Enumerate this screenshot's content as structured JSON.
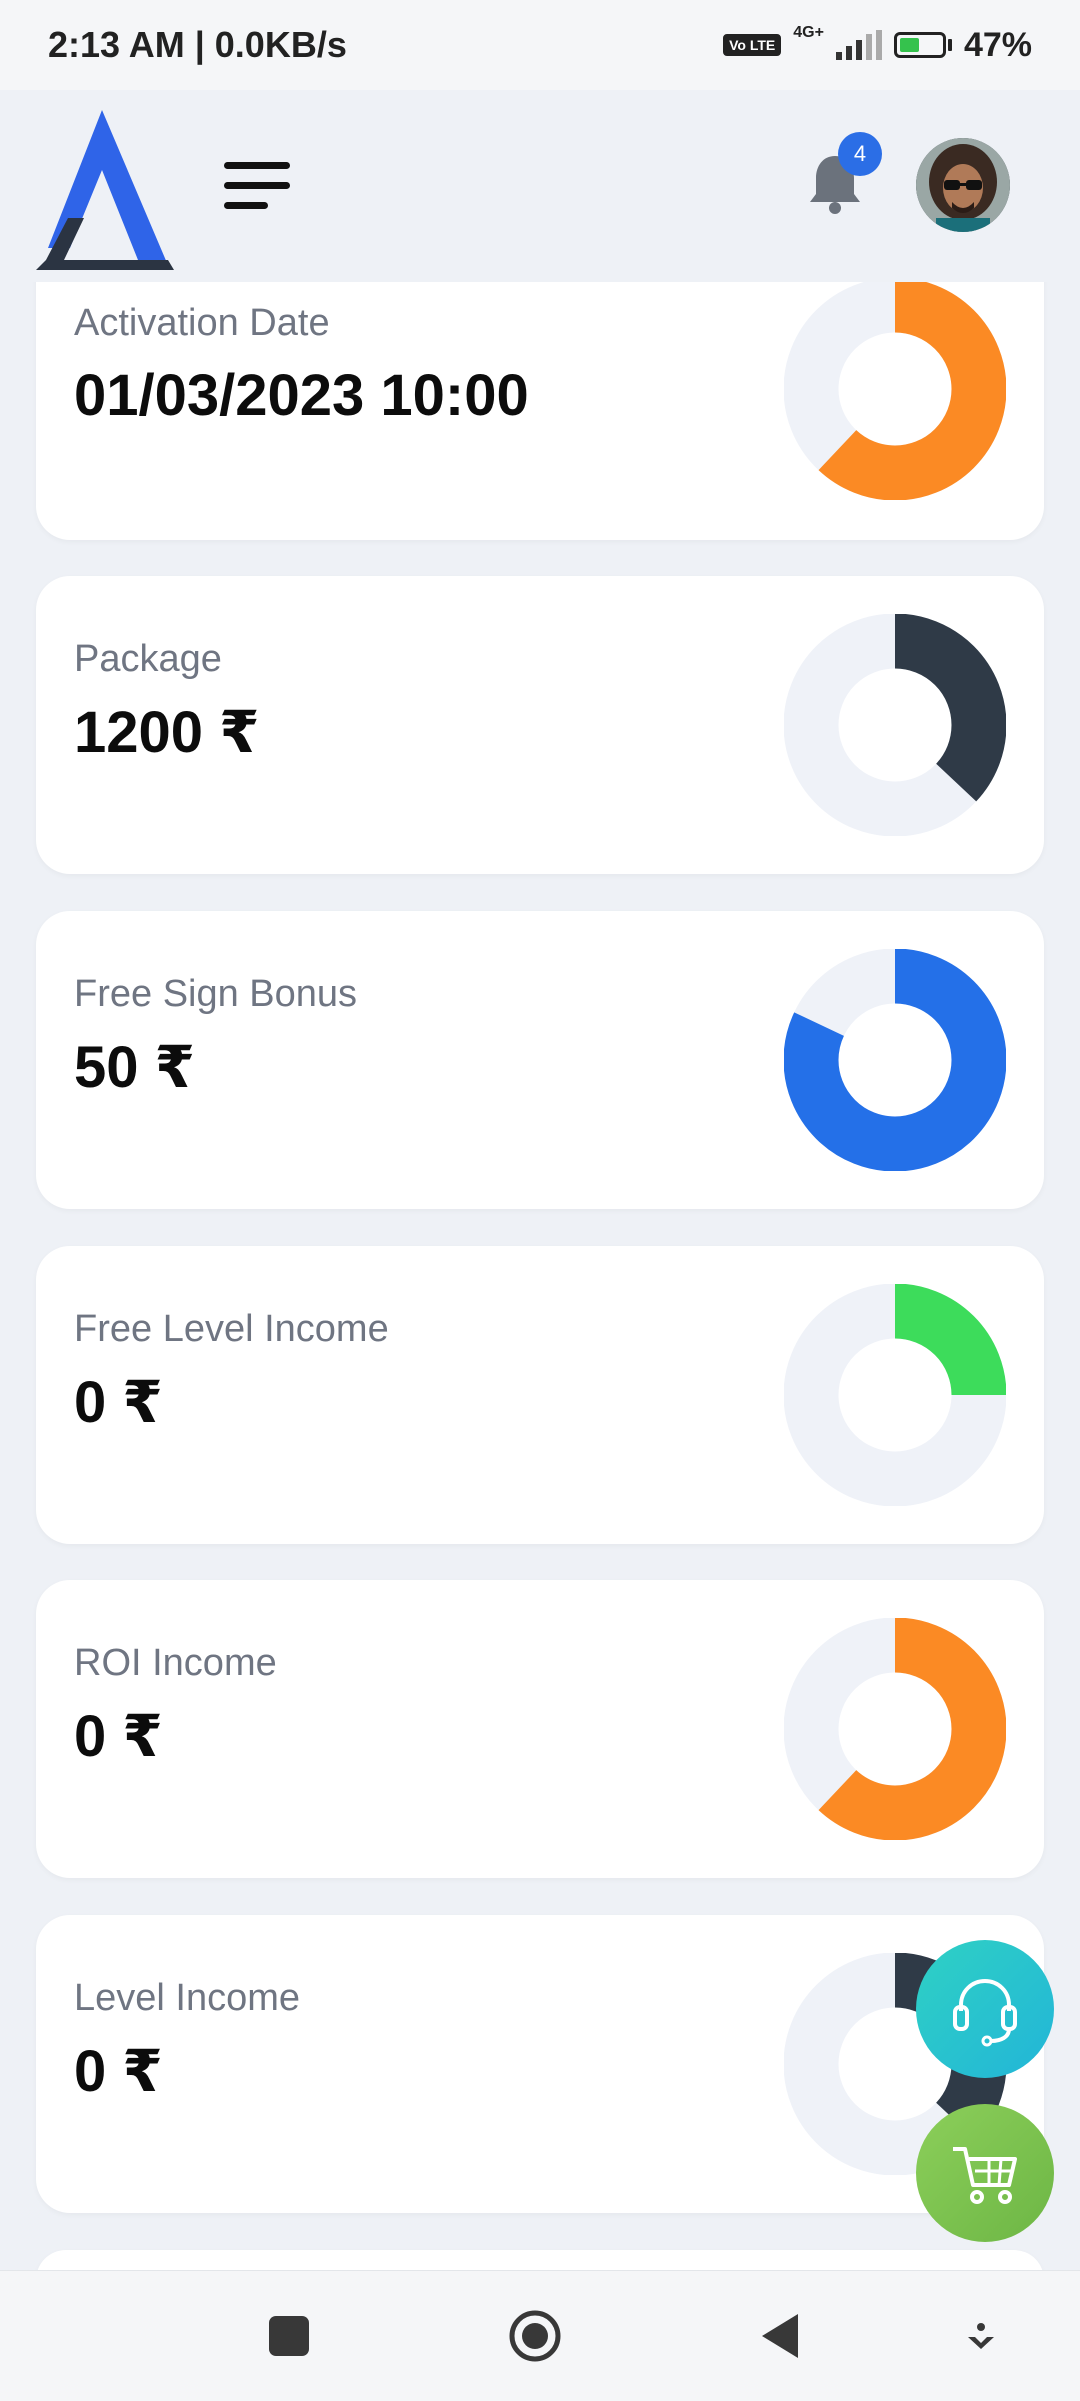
{
  "status_bar": {
    "time_speed": "2:13 AM | 0.0KB/s",
    "volte": "Vo LTE",
    "network": "4G+",
    "battery_percent": "47%",
    "battery_level": 0.47
  },
  "header": {
    "notification_count": "4",
    "icons": [
      "app-logo",
      "hamburger-menu-icon",
      "bell-icon",
      "user-avatar"
    ]
  },
  "cards": [
    {
      "label": "Activation Date",
      "value": "01/03/2023 10:00",
      "ring_color": "#fb8a24",
      "ring_fraction": 0.62
    },
    {
      "label": "Package",
      "value": "1200 ₹",
      "ring_color": "#2f3a47",
      "ring_fraction": 0.37
    },
    {
      "label": "Free Sign Bonus",
      "value": "50 ₹",
      "ring_color": "#2470e8",
      "ring_fraction": 0.82
    },
    {
      "label": "Free Level Income",
      "value": "0 ₹",
      "ring_color": "#3ddc5b",
      "ring_fraction": 0.25
    },
    {
      "label": "ROI Income",
      "value": "0 ₹",
      "ring_color": "#fb8a24",
      "ring_fraction": 0.62
    },
    {
      "label": "Level Income",
      "value": "0 ₹",
      "ring_color": "#2f3a47",
      "ring_fraction": 0.37
    }
  ],
  "colors": {
    "background": "#eef1f6",
    "ring_track": "#eff2f8",
    "label_gray": "#6f7582",
    "badge_blue": "#2b6ee6",
    "support_teal": "#2fd1c4",
    "cart_green": "#7cc24f"
  },
  "floating_buttons": [
    "headset-icon",
    "cart-icon"
  ],
  "nav_bar": [
    "recents-square-icon",
    "home-circle-icon",
    "back-triangle-icon",
    "menu-down-icon"
  ]
}
